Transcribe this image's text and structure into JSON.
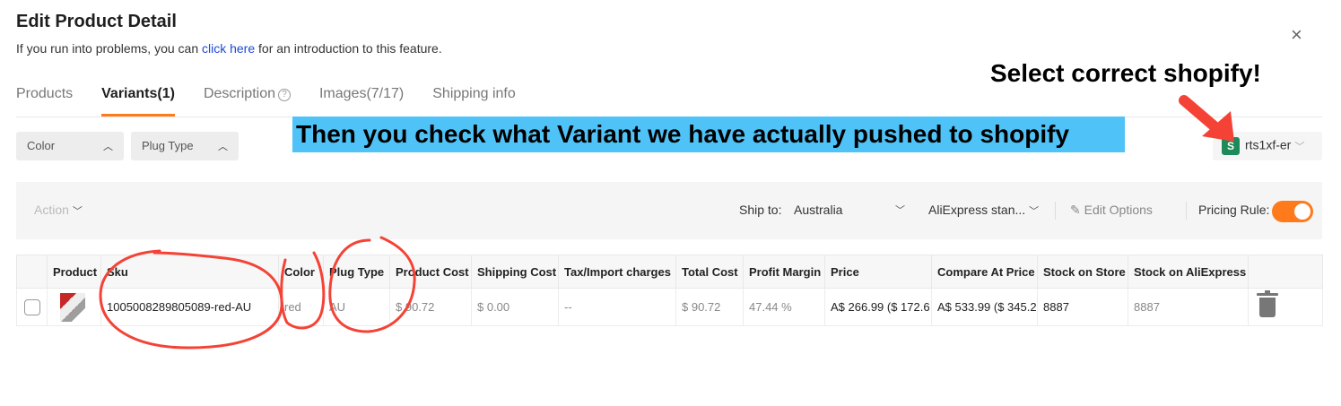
{
  "header": {
    "title": "Edit Product Detail",
    "intro_before": "If you run into problems, you can ",
    "intro_link": "click here",
    "intro_after": " for an introduction to this feature.",
    "close": "×"
  },
  "tabs": [
    {
      "label": "Products"
    },
    {
      "label": "Variants(1)"
    },
    {
      "label": "Description"
    },
    {
      "label": "Images(7/17)"
    },
    {
      "label": "Shipping info"
    }
  ],
  "annotations": {
    "top": "Select correct shopify!",
    "middle": "Then you check what Variant we have actually pushed to shopify"
  },
  "filters": [
    {
      "label": "Color",
      "chevron": "︿"
    },
    {
      "label": "Plug Type",
      "chevron": "︿"
    }
  ],
  "store": {
    "icon": "S",
    "name": "rts1xf-er",
    "chevron": "﹀"
  },
  "toolbar": {
    "action": "Action",
    "ship_to_label": "Ship to:",
    "ship_to_value": "Australia",
    "shipping_method": "AliExpress stan...",
    "edit_options": "Edit Options",
    "pricing_rule": "Pricing Rule:"
  },
  "table": {
    "headers": [
      "",
      "Product",
      "Sku",
      "Color",
      "Plug Type",
      "Product Cost",
      "Shipping Cost",
      "Tax/Import charges",
      "Total Cost",
      "Profit Margin",
      "Price",
      "Compare At Price",
      "Stock on Store",
      "Stock on  AliExpress",
      ""
    ],
    "row": {
      "sku": "1005008289805089-red-AU",
      "color": "red",
      "plug_type": "AU",
      "product_cost": "$ 90.72",
      "shipping_cost": "$ 0.00",
      "tax": "--",
      "total_cost": "$ 90.72",
      "profit_margin": "47.44 %",
      "price": "A$ 266.99 ($ 172.6",
      "compare_price": "A$ 533.99 ($ 345.2",
      "stock_store": "8887",
      "stock_ali": "8887"
    }
  },
  "colors": {
    "accent": "#ff7a1a",
    "link": "#1c49d4",
    "highlight": "#4fc3f7",
    "annotation_red": "#f44336"
  }
}
